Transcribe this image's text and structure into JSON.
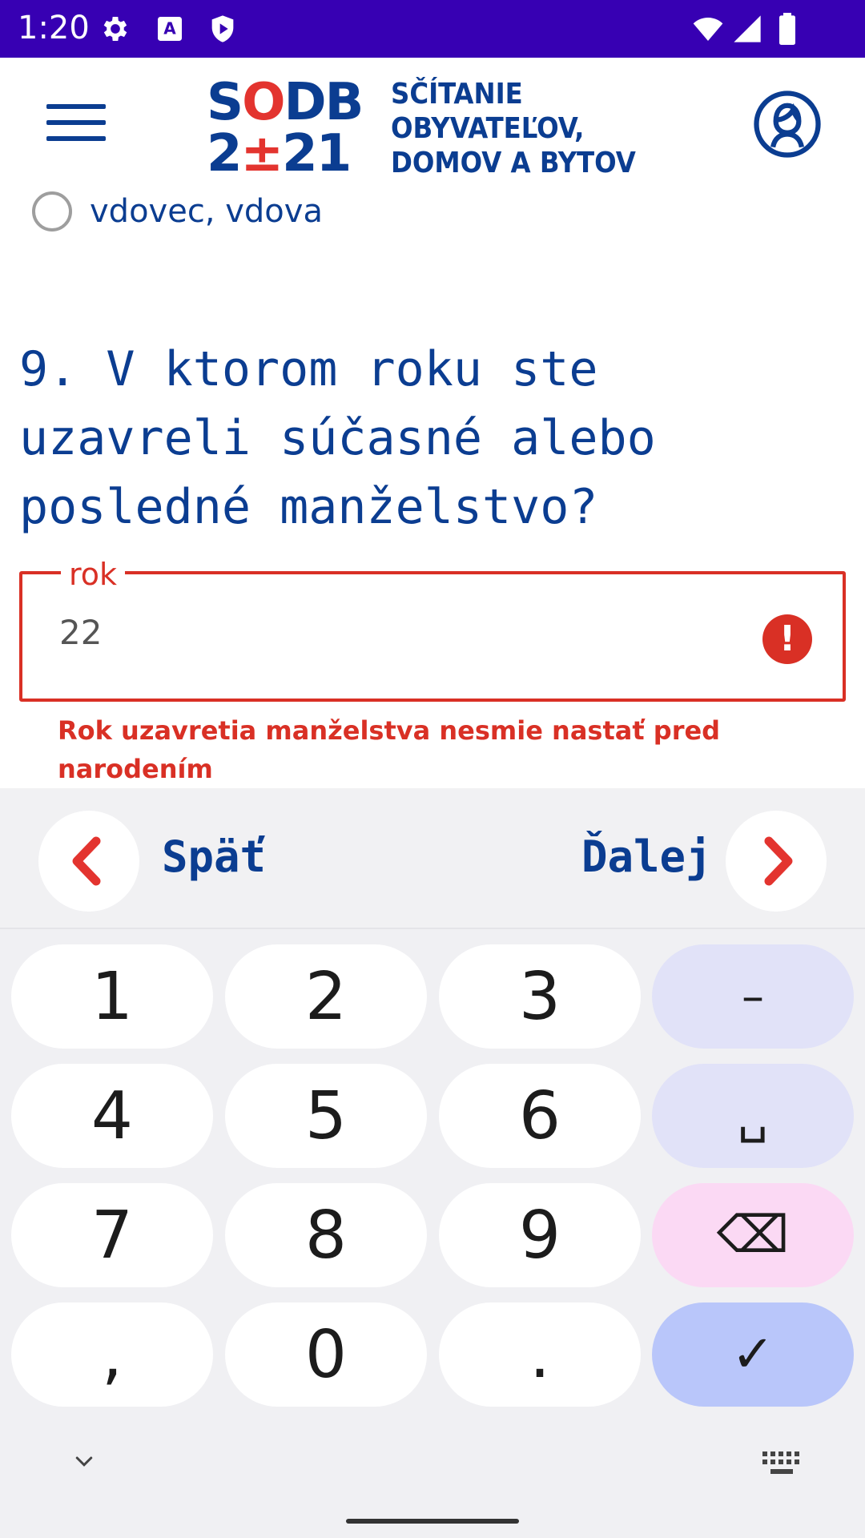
{
  "status_bar": {
    "time": "1:20",
    "icons": [
      "settings-icon",
      "a-badge-icon",
      "shield-play-icon",
      "wifi-icon",
      "signal-icon",
      "battery-icon"
    ],
    "background": "#3700b3"
  },
  "header": {
    "logo_top": "SODB",
    "logo_bottom": "2±21",
    "logo_text": "SČÍTANIE\nOBYVATEĽOV,\nDOMOV A BYTOV",
    "menu_icon": "hamburger-icon",
    "profile_icon": "user-profile-icon"
  },
  "form": {
    "radio_option": "vdovec, vdova",
    "question": "9. V ktorom roku ste uzavreli súčasné alebo posledné manželstvo?",
    "field_label": "rok",
    "field_value": "22",
    "error_icon": "!",
    "error_message": "Rok uzavretia manželstva nesmie nastať pred narodením"
  },
  "navigation": {
    "back_label": "Späť",
    "next_label": "Ďalej"
  },
  "keyboard": {
    "keys": [
      {
        "label": "1",
        "type": "digit"
      },
      {
        "label": "2",
        "type": "digit"
      },
      {
        "label": "3",
        "type": "digit"
      },
      {
        "label": "–",
        "type": "fn"
      },
      {
        "label": "4",
        "type": "digit"
      },
      {
        "label": "5",
        "type": "digit"
      },
      {
        "label": "6",
        "type": "digit"
      },
      {
        "label": "␣",
        "type": "fn"
      },
      {
        "label": "7",
        "type": "digit"
      },
      {
        "label": "8",
        "type": "digit"
      },
      {
        "label": "9",
        "type": "digit"
      },
      {
        "label": "⌫",
        "type": "del"
      },
      {
        "label": ",",
        "type": "digit"
      },
      {
        "label": "0",
        "type": "digit"
      },
      {
        "label": ".",
        "type": "digit"
      },
      {
        "label": "✓",
        "type": "ok"
      }
    ]
  },
  "colors": {
    "brand_blue": "#0b3d91",
    "error_red": "#d93025",
    "logo_red": "#e3342f"
  }
}
